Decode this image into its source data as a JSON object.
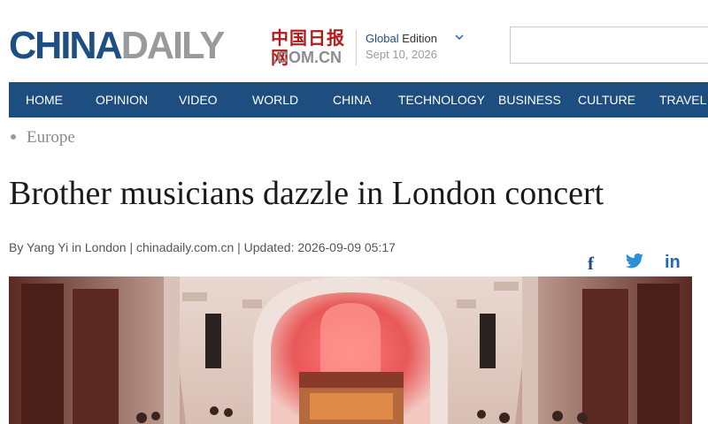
{
  "header": {
    "logo_en_main": "CHINA",
    "logo_en_daily": "DAILY",
    "logo_cn": "中国日报网",
    "logo_domain": ".COM.CN",
    "edition_prefix": "Global",
    "edition_word": "Edition",
    "date": "Sept 10, 2026",
    "search": {
      "placeholder": ""
    }
  },
  "nav": {
    "items": [
      {
        "label": "HOME"
      },
      {
        "label": "OPINION"
      },
      {
        "label": "VIDEO"
      },
      {
        "label": "WORLD"
      },
      {
        "label": "CHINA"
      },
      {
        "label": "TECHNOLOGY"
      },
      {
        "label": "BUSINESS"
      },
      {
        "label": "CULTURE"
      },
      {
        "label": "TRAVEL"
      }
    ]
  },
  "breadcrumb": {
    "label": "Europe"
  },
  "article": {
    "title": "Brother musicians dazzle in London concert",
    "byline": "By Yang Yi in London | chinadaily.com.cn | Updated: 2026-09-09 05:17"
  },
  "share": {
    "facebook": "f",
    "linkedin": "in",
    "icons": [
      "facebook-icon",
      "twitter-icon",
      "linkedin-icon"
    ]
  },
  "colors": {
    "brand_blue": "#1f4e83",
    "nav_bg": "#1e4e7f",
    "logo_red": "#b41b1b"
  }
}
